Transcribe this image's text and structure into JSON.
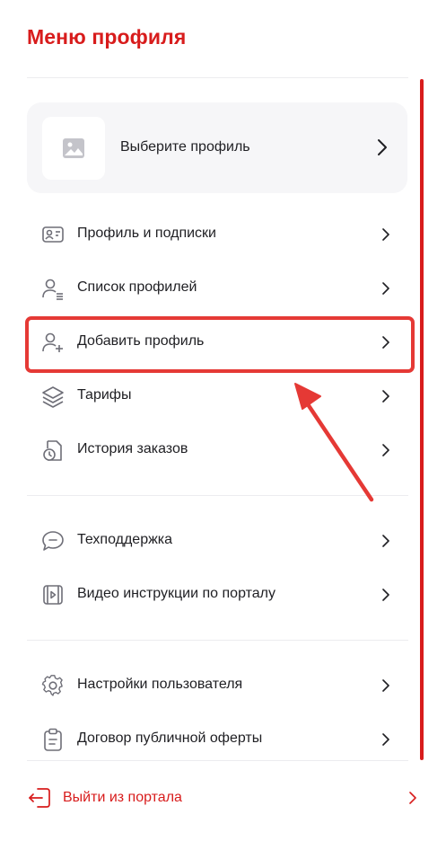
{
  "header": {
    "title": "Меню профиля"
  },
  "profile_selector": {
    "label": "Выберите профиль"
  },
  "menu": {
    "group1": [
      {
        "label": "Профиль и подписки",
        "icon": "profile-card-icon"
      },
      {
        "label": "Список профилей",
        "icon": "user-list-icon"
      },
      {
        "label": "Добавить профиль",
        "icon": "user-add-icon"
      },
      {
        "label": "Тарифы",
        "icon": "layers-icon"
      },
      {
        "label": "История заказов",
        "icon": "order-history-icon"
      }
    ],
    "group2": [
      {
        "label": "Техподдержка",
        "icon": "support-chat-icon"
      },
      {
        "label": "Видео инструкции по порталу",
        "icon": "video-instructions-icon"
      }
    ],
    "group3": [
      {
        "label": "Настройки пользователя",
        "icon": "gear-icon"
      },
      {
        "label": "Договор публичной оферты",
        "icon": "clipboard-icon"
      }
    ]
  },
  "logout": {
    "label": "Выйти из портала"
  },
  "colors": {
    "accent": "#d81c1c",
    "highlight": "#e53935",
    "text": "#1f1f23",
    "icon": "#6e6e77",
    "card_bg": "#f6f6f8"
  }
}
